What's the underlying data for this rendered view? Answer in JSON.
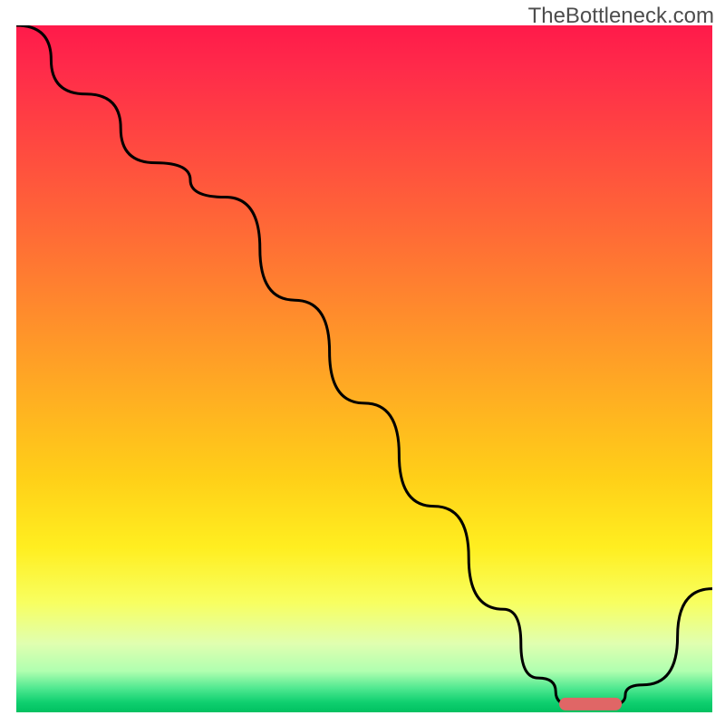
{
  "watermark": "TheBottleneck.com",
  "chart_data": {
    "type": "line",
    "title": "",
    "xlabel": "",
    "ylabel": "",
    "xlim": [
      0,
      100
    ],
    "ylim": [
      0,
      100
    ],
    "x": [
      0,
      10,
      20,
      30,
      40,
      50,
      60,
      70,
      75,
      80,
      85,
      90,
      100
    ],
    "values": [
      100,
      90,
      80,
      75,
      60,
      45,
      30,
      15,
      5,
      1,
      1,
      4,
      18
    ],
    "marker": {
      "x_start": 78,
      "x_end": 87,
      "y": 1.2
    },
    "gradient_stops": [
      {
        "offset": 0.0,
        "color": "#ff1a4a"
      },
      {
        "offset": 0.06,
        "color": "#ff2a4a"
      },
      {
        "offset": 0.18,
        "color": "#ff4a40"
      },
      {
        "offset": 0.3,
        "color": "#ff6a36"
      },
      {
        "offset": 0.42,
        "color": "#ff8c2c"
      },
      {
        "offset": 0.54,
        "color": "#ffae22"
      },
      {
        "offset": 0.66,
        "color": "#ffd018"
      },
      {
        "offset": 0.76,
        "color": "#ffee20"
      },
      {
        "offset": 0.84,
        "color": "#f8ff60"
      },
      {
        "offset": 0.9,
        "color": "#e0ffb0"
      },
      {
        "offset": 0.94,
        "color": "#b0ffb0"
      },
      {
        "offset": 0.965,
        "color": "#50e890"
      },
      {
        "offset": 0.985,
        "color": "#10d070"
      },
      {
        "offset": 1.0,
        "color": "#00c060"
      }
    ],
    "marker_color": "#e06666",
    "curve_color": "#000000",
    "curve_width": 3
  }
}
